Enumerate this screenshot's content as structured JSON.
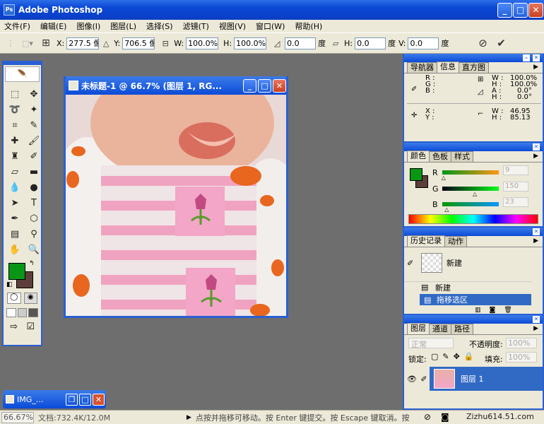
{
  "app": {
    "title": "Adobe Photoshop",
    "logo_text": "Ps"
  },
  "window_buttons": {
    "minimize": "_",
    "maximize": "□",
    "close": "✕"
  },
  "menu": [
    "文件(F)",
    "编辑(E)",
    "图像(I)",
    "图层(L)",
    "选择(S)",
    "滤镜(T)",
    "视图(V)",
    "窗口(W)",
    "帮助(H)"
  ],
  "options": {
    "x_label": "X:",
    "x_value": "277.5 像",
    "y_label": "Y:",
    "y_value": "706.5 像",
    "w_label": "W:",
    "w_value": "100.0%",
    "h_label": "H:",
    "h_value": "100.0%",
    "angle_value": "0.0",
    "angle_unit": "度",
    "skew_h_label": "H:",
    "skew_h_value": "0.0",
    "skew_h_unit": "度",
    "skew_v_label": "V:",
    "skew_v_value": "0.0",
    "skew_v_unit": "度"
  },
  "document": {
    "title": "未标题-1 @ 66.7% (图层 1, RG...",
    "min": "_",
    "max": "□",
    "close": "✕"
  },
  "info_panel": {
    "tabs": [
      "导航器",
      "信息",
      "直方图"
    ],
    "active_tab": "信息",
    "r_label": "R :",
    "g_label": "G :",
    "b_label": "B :",
    "w_pct_label": "W :",
    "w_pct": "100.0%",
    "h_pct_label": "H :",
    "h_pct": "100.0%",
    "a_label": "A :",
    "a_val": "0.0°",
    "h2_label": "H :",
    "h2_val": "0.0°",
    "x_label": "X :",
    "y_label": "Y :",
    "w_label": "W :",
    "w_val": "46.95",
    "h_label": "H :",
    "h_val": "85.13"
  },
  "color_panel": {
    "tabs": [
      "颜色",
      "色板",
      "样式"
    ],
    "r_label": "R",
    "r_val": "9",
    "g_label": "G",
    "g_val": "150",
    "b_label": "B",
    "b_val": "23",
    "r_level": 0.035,
    "g_level": 0.588,
    "b_level": 0.09,
    "foreground": "#099617"
  },
  "history_panel": {
    "tabs": [
      "历史记录",
      "动作"
    ],
    "snapshot_label": "新建",
    "items": [
      "新建",
      "拖移选区"
    ]
  },
  "layers_panel": {
    "tabs": [
      "图层",
      "通道",
      "路径"
    ],
    "blend_mode": "正常",
    "opacity_label": "不透明度:",
    "opacity_val": "100%",
    "lock_label": "锁定:",
    "fill_label": "填充:",
    "fill_val": "100%",
    "layer_name": "图层 1"
  },
  "minimized": {
    "title": "IMG_..."
  },
  "status": {
    "zoom": "66.67%",
    "doc": "文档:732.4K/12.0M",
    "hint": "点按并拖移可移动。按 Enter 键提交。按 Escape 键取消。按",
    "watermark": "Zizhu614.51.com"
  }
}
